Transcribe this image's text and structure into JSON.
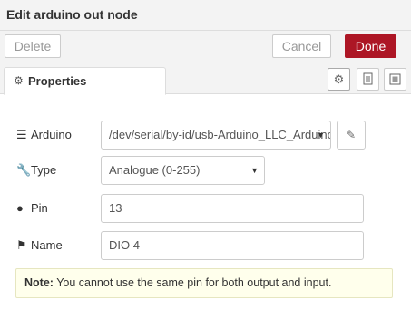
{
  "dialog": {
    "title": "Edit arduino out node"
  },
  "toolbar": {
    "delete_label": "Delete",
    "cancel_label": "Cancel",
    "done_label": "Done"
  },
  "tabs": [
    {
      "label": "Properties",
      "active": true
    }
  ],
  "form": {
    "arduino": {
      "label": "Arduino",
      "value": "/dev/serial/by-id/usb-Arduino_LLC_Arduino_"
    },
    "type": {
      "label": "Type",
      "value": "Analogue (0-255)"
    },
    "pin": {
      "label": "Pin",
      "value": "13"
    },
    "name": {
      "label": "Name",
      "value": "DIO 4"
    }
  },
  "note": {
    "strong": "Note:",
    "text": " You cannot use the same pin for both output and input."
  },
  "colors": {
    "done_bg": "#ad1625",
    "header_bg": "#f3f3f3",
    "note_bg": "#ffffec"
  },
  "icons": [
    "cog-icon",
    "file-text-icon",
    "appearance-icon",
    "list-icon",
    "wrench-icon",
    "circle-icon",
    "tag-icon",
    "pencil-icon",
    "caret-down-icon"
  ]
}
